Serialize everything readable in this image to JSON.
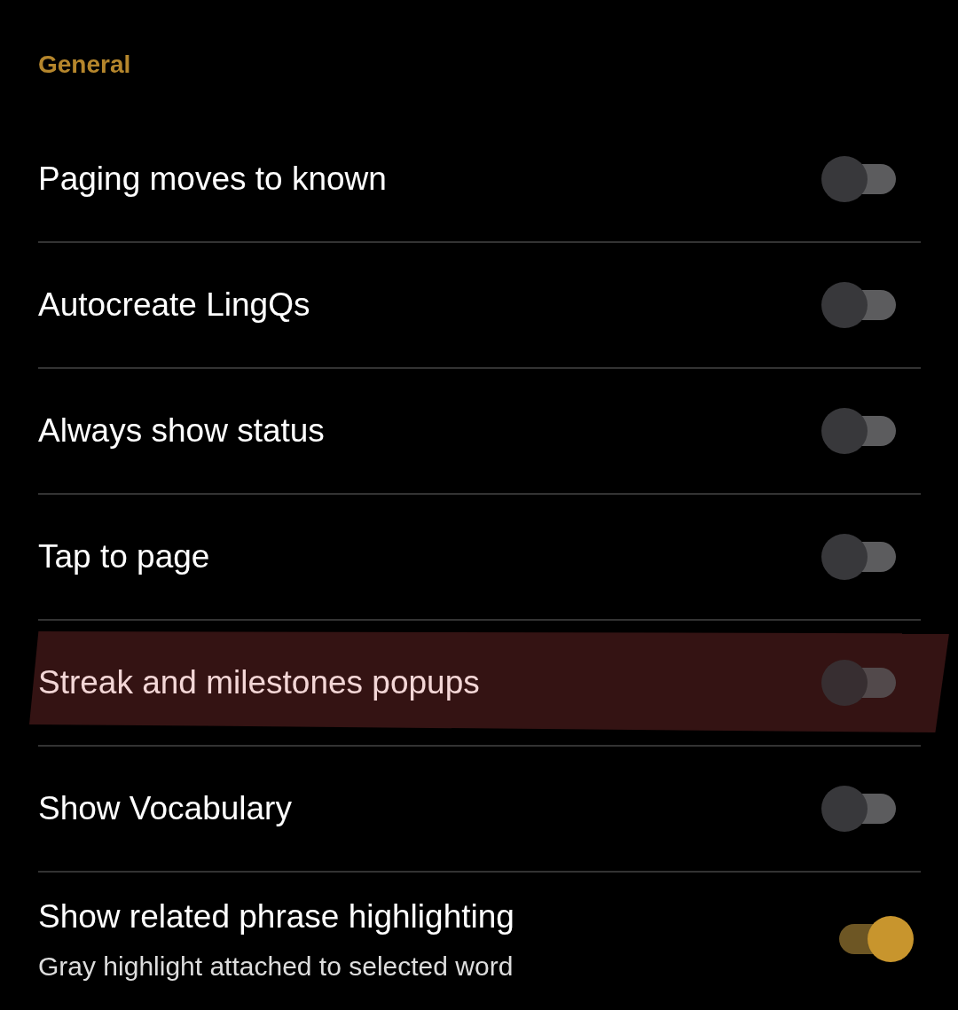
{
  "section_title": "General",
  "settings": [
    {
      "title": "Paging moves to known",
      "on": false,
      "highlighted": false
    },
    {
      "title": "Autocreate LingQs",
      "on": false,
      "highlighted": false
    },
    {
      "title": "Always show status",
      "on": false,
      "highlighted": false
    },
    {
      "title": "Tap to page",
      "on": false,
      "highlighted": false
    },
    {
      "title": "Streak and milestones popups",
      "on": false,
      "highlighted": true
    },
    {
      "title": "Show Vocabulary",
      "on": false,
      "highlighted": false
    },
    {
      "title": "Show related phrase highlighting",
      "subtitle": "Gray highlight attached to selected word",
      "on": true,
      "highlighted": false
    }
  ]
}
